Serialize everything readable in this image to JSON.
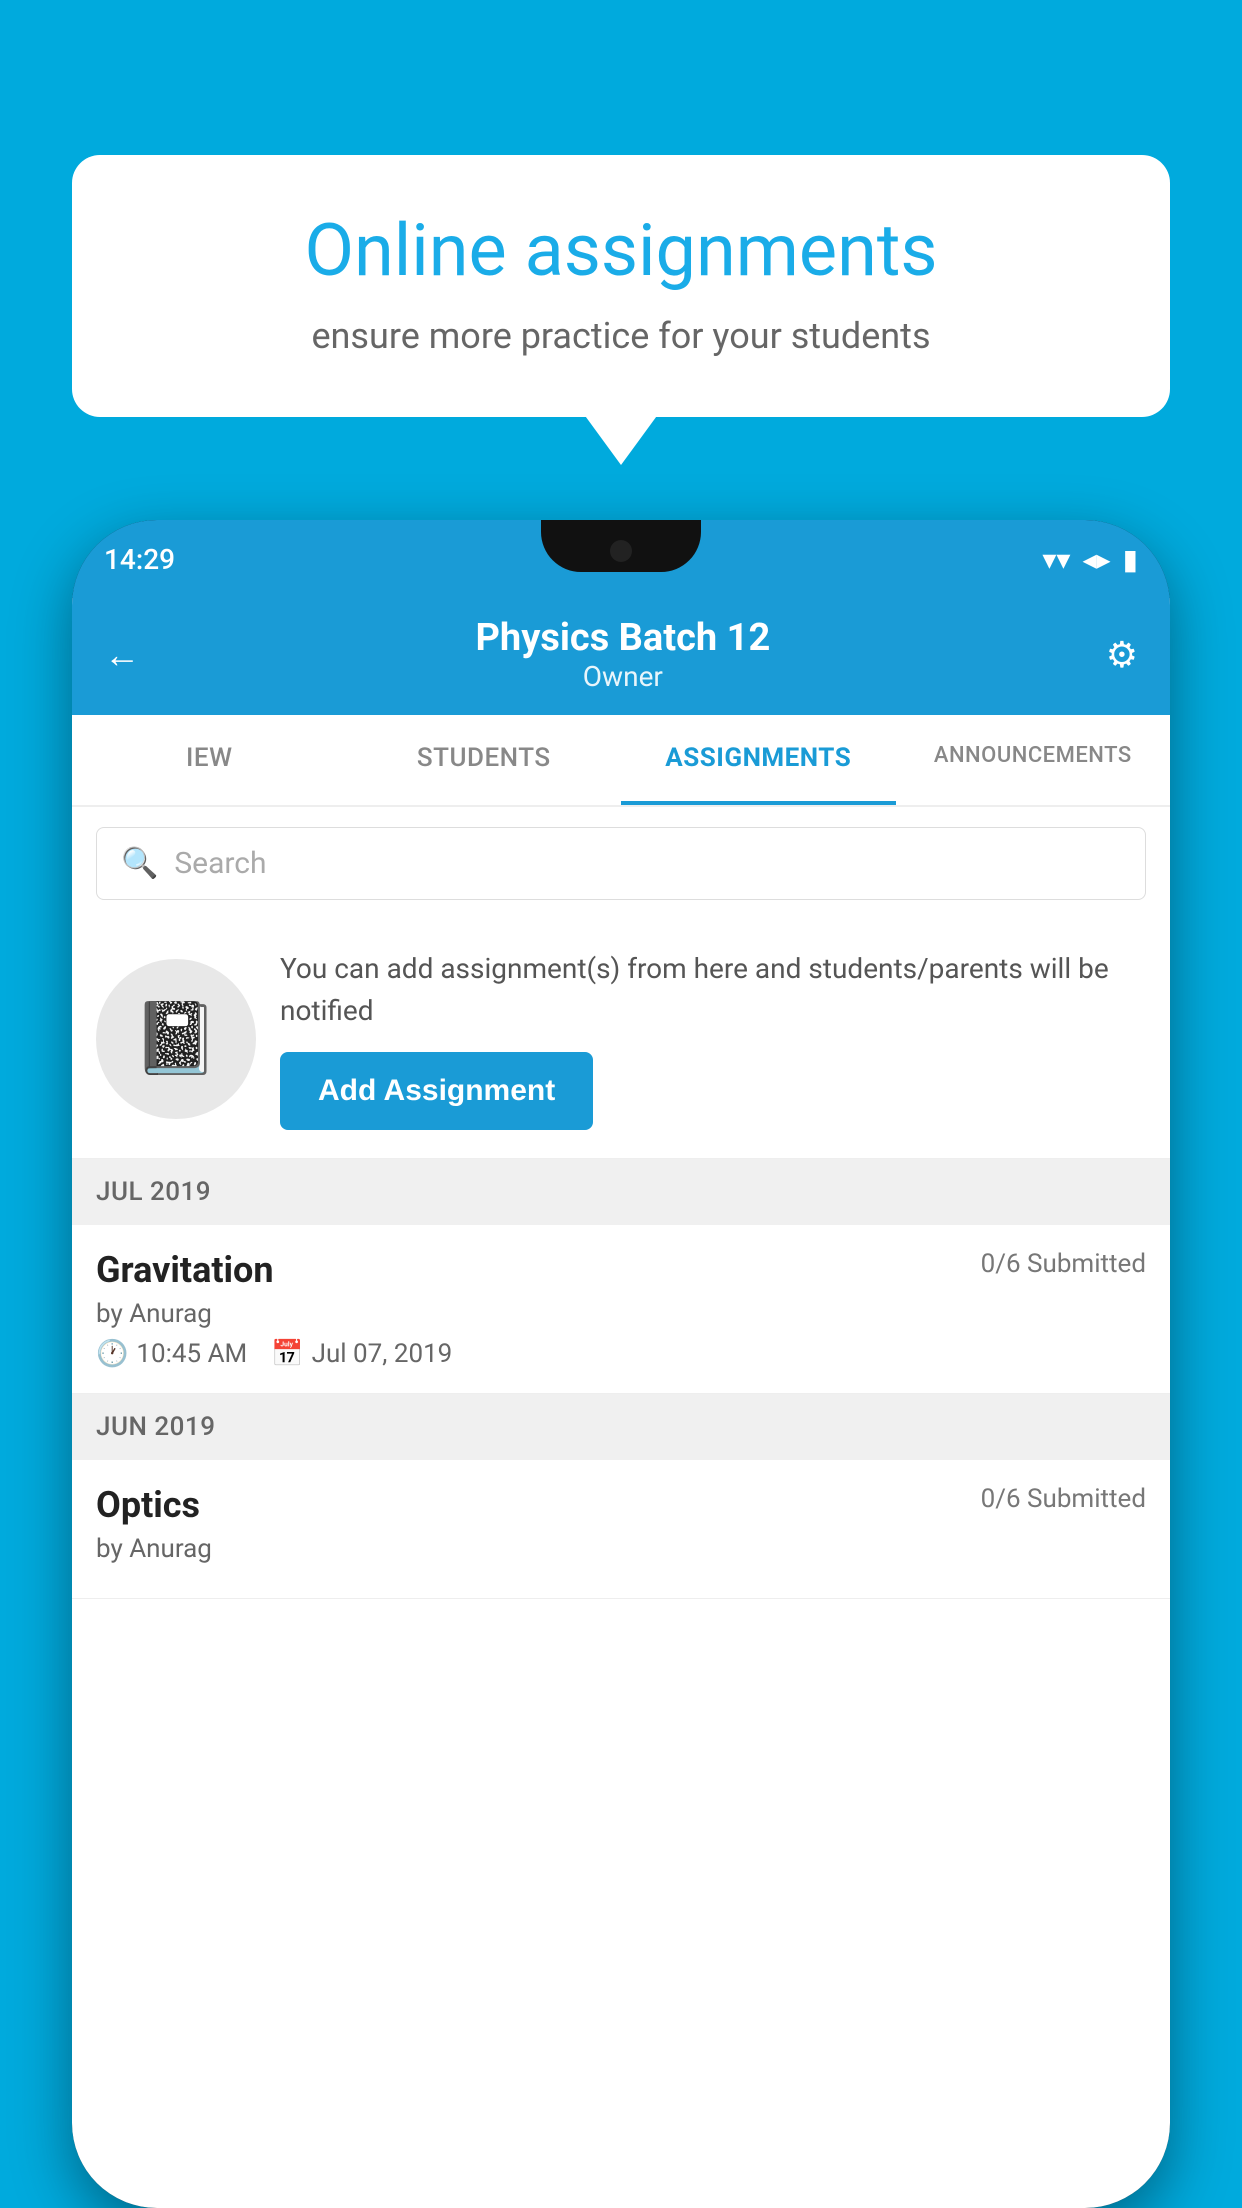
{
  "background": {
    "color": "#00AADD"
  },
  "speech_bubble": {
    "title": "Online assignments",
    "subtitle": "ensure more practice for your students"
  },
  "phone": {
    "status_bar": {
      "time": "14:29",
      "wifi": "▲",
      "signal": "▲",
      "battery": "▮"
    },
    "header": {
      "back_label": "←",
      "title": "Physics Batch 12",
      "subtitle": "Owner",
      "settings_icon": "⚙"
    },
    "tabs": [
      {
        "label": "IEW",
        "active": false
      },
      {
        "label": "STUDENTS",
        "active": false
      },
      {
        "label": "ASSIGNMENTS",
        "active": true
      },
      {
        "label": "ANNOUNCEMENTS",
        "active": false
      }
    ],
    "search": {
      "placeholder": "Search"
    },
    "promo": {
      "description": "You can add assignment(s) from here and students/parents will be notified",
      "button_label": "Add Assignment"
    },
    "sections": [
      {
        "header": "JUL 2019",
        "assignments": [
          {
            "name": "Gravitation",
            "submitted": "0/6 Submitted",
            "by": "by Anurag",
            "time": "10:45 AM",
            "date": "Jul 07, 2019"
          }
        ]
      },
      {
        "header": "JUN 2019",
        "assignments": [
          {
            "name": "Optics",
            "submitted": "0/6 Submitted",
            "by": "by Anurag",
            "time": "",
            "date": ""
          }
        ]
      }
    ]
  }
}
